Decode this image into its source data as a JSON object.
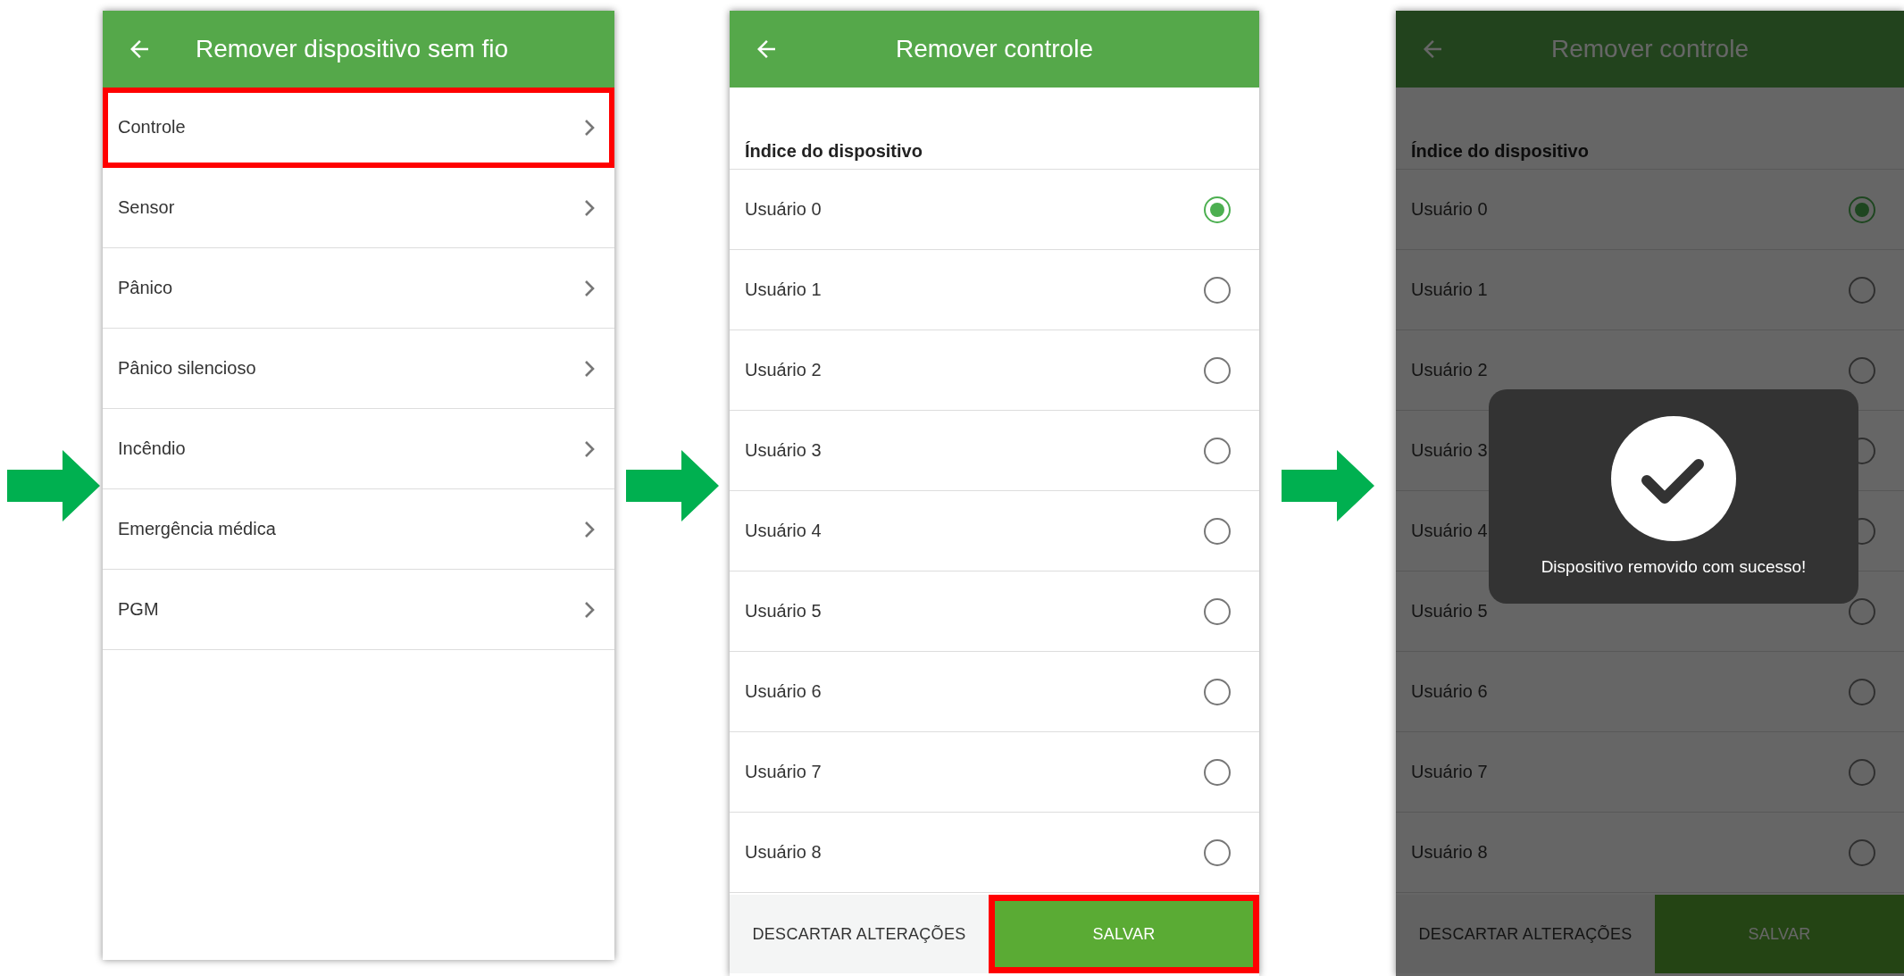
{
  "screens": [
    {
      "kind": "menu",
      "title": "Remover dispositivo sem fio",
      "items": [
        {
          "label": "Controle",
          "highlighted": true
        },
        {
          "label": "Sensor",
          "highlighted": false
        },
        {
          "label": "Pânico",
          "highlighted": false
        },
        {
          "label": "Pânico silencioso",
          "highlighted": false
        },
        {
          "label": "Incêndio",
          "highlighted": false
        },
        {
          "label": "Emergência médica",
          "highlighted": false
        },
        {
          "label": "PGM",
          "highlighted": false
        }
      ]
    },
    {
      "kind": "radio_list",
      "title": "Remover controle",
      "section_label": "Índice do dispositivo",
      "options": [
        {
          "label": "Usuário 0",
          "selected": true
        },
        {
          "label": "Usuário 1",
          "selected": false
        },
        {
          "label": "Usuário 2",
          "selected": false
        },
        {
          "label": "Usuário 3",
          "selected": false
        },
        {
          "label": "Usuário 4",
          "selected": false
        },
        {
          "label": "Usuário 5",
          "selected": false
        },
        {
          "label": "Usuário 6",
          "selected": false
        },
        {
          "label": "Usuário 7",
          "selected": false
        },
        {
          "label": "Usuário 8",
          "selected": false
        }
      ],
      "discard_button": {
        "label": "DESCARTAR ALTERAÇÕES",
        "highlighted": false
      },
      "save_button": {
        "label": "SALVAR",
        "highlighted": true
      }
    },
    {
      "kind": "radio_list",
      "title": "Remover controle",
      "section_label": "Índice do dispositivo",
      "options": [
        {
          "label": "Usuário 0",
          "selected": true
        },
        {
          "label": "Usuário 1",
          "selected": false
        },
        {
          "label": "Usuário 2",
          "selected": false
        },
        {
          "label": "Usuário 3",
          "selected": false
        },
        {
          "label": "Usuário 4",
          "selected": false
        },
        {
          "label": "Usuário 5",
          "selected": false
        },
        {
          "label": "Usuário 6",
          "selected": false
        },
        {
          "label": "Usuário 7",
          "selected": false
        },
        {
          "label": "Usuário 8",
          "selected": false
        }
      ],
      "discard_button": {
        "label": "DESCARTAR ALTERAÇÕES",
        "highlighted": false
      },
      "save_button": {
        "label": "SALVAR",
        "highlighted": false
      },
      "toast": {
        "message": "Dispositivo removido com sucesso!"
      }
    }
  ]
}
